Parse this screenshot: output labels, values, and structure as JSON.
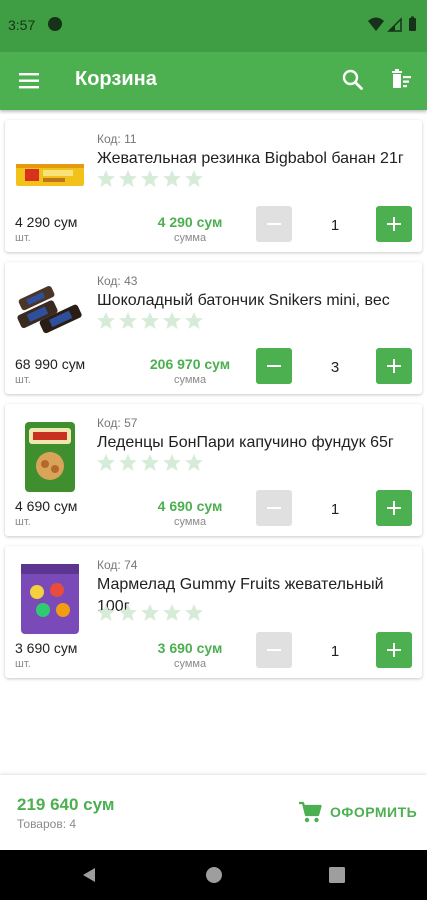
{
  "status_bar": {
    "time": "3:57"
  },
  "app_bar": {
    "title": "Корзина",
    "menu_icon": "menu-icon",
    "search_icon": "search-icon",
    "clear_icon": "clear-cart-icon"
  },
  "cart_items": [
    {
      "code": "Код: 11",
      "name": "Жевательная резинка Bigbabol банан 21г",
      "rating": 0,
      "price": "4 290 сум",
      "unit": "шт.",
      "sum": "4 290 сум",
      "sum_label": "сумма",
      "qty": "1",
      "image": "bigbabol-gum-image"
    },
    {
      "code": "Код: 43",
      "name": "Шоколадный батончик Snikers mini, вес",
      "rating": 0,
      "price": "68 990 сум",
      "unit": "шт.",
      "sum": "206 970 сум",
      "sum_label": "сумма",
      "qty": "3",
      "image": "snickers-mini-image"
    },
    {
      "code": "Код: 57",
      "name": "Леденцы БонПари капучино фундук 65г",
      "rating": 0,
      "price": "4 690 сум",
      "unit": "шт.",
      "sum": "4 690 сум",
      "sum_label": "сумма",
      "qty": "1",
      "image": "bonpari-candy-image"
    },
    {
      "code": "Код: 74",
      "name": "Мармелад Gummy Fruits жевательный 100г",
      "rating": 0,
      "price": "3 690 сум",
      "unit": "шт.",
      "sum": "3 690 сум",
      "sum_label": "сумма",
      "qty": "1",
      "image": "gummy-fruits-image"
    }
  ],
  "footer": {
    "total": "219 640 сум",
    "count": "Товаров: 4",
    "checkout_label": "ОФОРМИТЬ",
    "checkout_icon": "cart-icon"
  },
  "colors": {
    "primary": "#4caf50",
    "status_bar": "#3f9e43",
    "disabled": "#e0e0e0",
    "star": "#d7ecd8"
  }
}
